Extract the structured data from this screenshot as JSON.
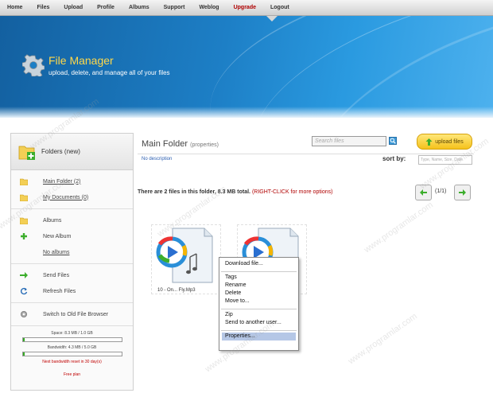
{
  "nav": {
    "items": [
      "Home",
      "Files",
      "Upload",
      "Profile",
      "Albums",
      "Support",
      "Weblog",
      "Upgrade",
      "Logout"
    ]
  },
  "banner": {
    "title": "File Manager",
    "subtitle": "upload, delete, and manage all of your files"
  },
  "sidebar": {
    "header": "Folders (new)",
    "folders": [
      "Main Folder (2)",
      "My Documents (0)"
    ],
    "albums_label": "Albums",
    "new_album": "New Album",
    "no_albums": "No albums",
    "send_files": "Send Files",
    "refresh_files": "Refresh Files",
    "switch_browser": "Switch to Old File Browser",
    "space_text": "Space: 8.3 MB / 1.0 GB",
    "space_fraction": 0.008,
    "bandwidth_text": "Bandwidth: 4.3 MB / 5.0 GB",
    "bandwidth_fraction": 0.001,
    "reset_note": "Next bandwidth reset in 30 day(s)",
    "plan": "Free plan"
  },
  "main": {
    "folder_title": "Main Folder",
    "properties_link": "(properties)",
    "search_placeholder": "Search files",
    "upload_label": "upload files",
    "no_description": "No description",
    "sort_label": "sort by:",
    "sort_placeholder": "Type, Name, Size, Date",
    "info_prefix": "There are 2 files in this folder, 8.3 MB total. ",
    "info_hint": "(RIGHT-CLICK for more options)",
    "pager": "(1/1)",
    "files": [
      {
        "name": "10 - On... Fly.Mp3"
      },
      {
        "name": ""
      }
    ]
  },
  "context_menu": {
    "items": [
      "Download file...",
      "Tags",
      "Rename",
      "Delete",
      "Move to...",
      "Zip",
      "Send to another user...",
      "Properties..."
    ]
  },
  "watermark": "www.programlar.com",
  "colors": {
    "upgrade": "#b00000",
    "banner_title": "#ffd84a",
    "progress": "#33aa22",
    "warning": "#c00000"
  }
}
